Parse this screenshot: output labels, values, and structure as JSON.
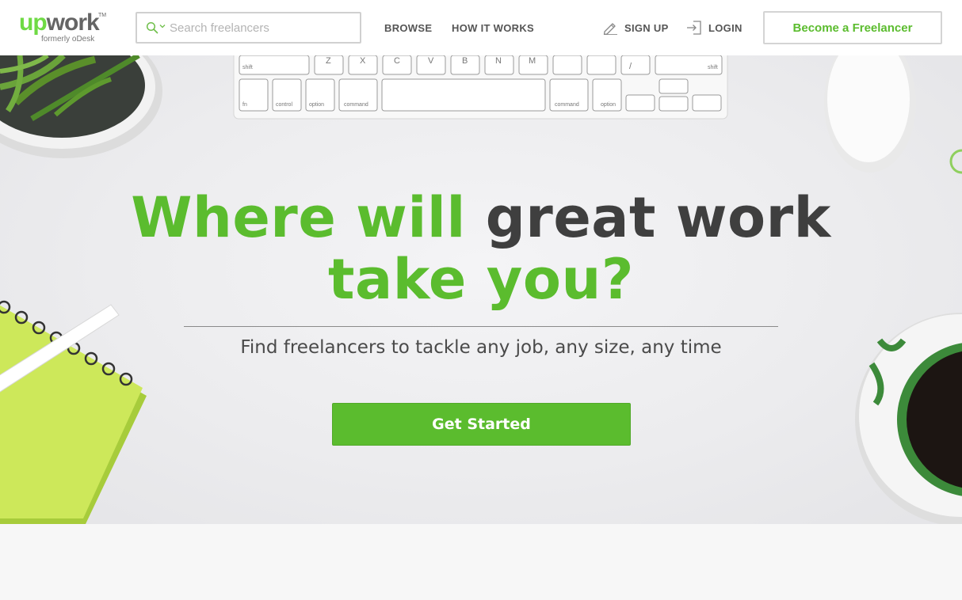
{
  "header": {
    "logo": {
      "word_up": "up",
      "word_work": "work",
      "tm": "TM",
      "subtitle": "formerly oDesk"
    },
    "search": {
      "placeholder": "Search freelancers",
      "value": ""
    },
    "nav": {
      "browse": "BROWSE",
      "how_it_works": "HOW IT WORKS",
      "sign_up": "SIGN UP",
      "login": "LOGIN"
    },
    "become_freelancer": "Become a Freelancer"
  },
  "hero": {
    "headline_line1_green": "Where will",
    "headline_line1_dark": "great work",
    "headline_line2": "take you?",
    "subheadline": "Find freelancers to tackle any job, any size, any time",
    "cta": "Get Started"
  },
  "keyboard": {
    "row1": [
      "shift",
      "Z",
      "X",
      "C",
      "V",
      "B",
      "N",
      "M",
      "<",
      ">",
      "?",
      "shift"
    ],
    "row2": [
      "fn",
      "control",
      "option",
      "command",
      "",
      "command",
      "option"
    ]
  },
  "colors": {
    "brand_green": "#5bbc2e",
    "logo_green": "#6fda44",
    "headline_dark": "#3f3f3f",
    "header_bg": "#ffffff"
  }
}
